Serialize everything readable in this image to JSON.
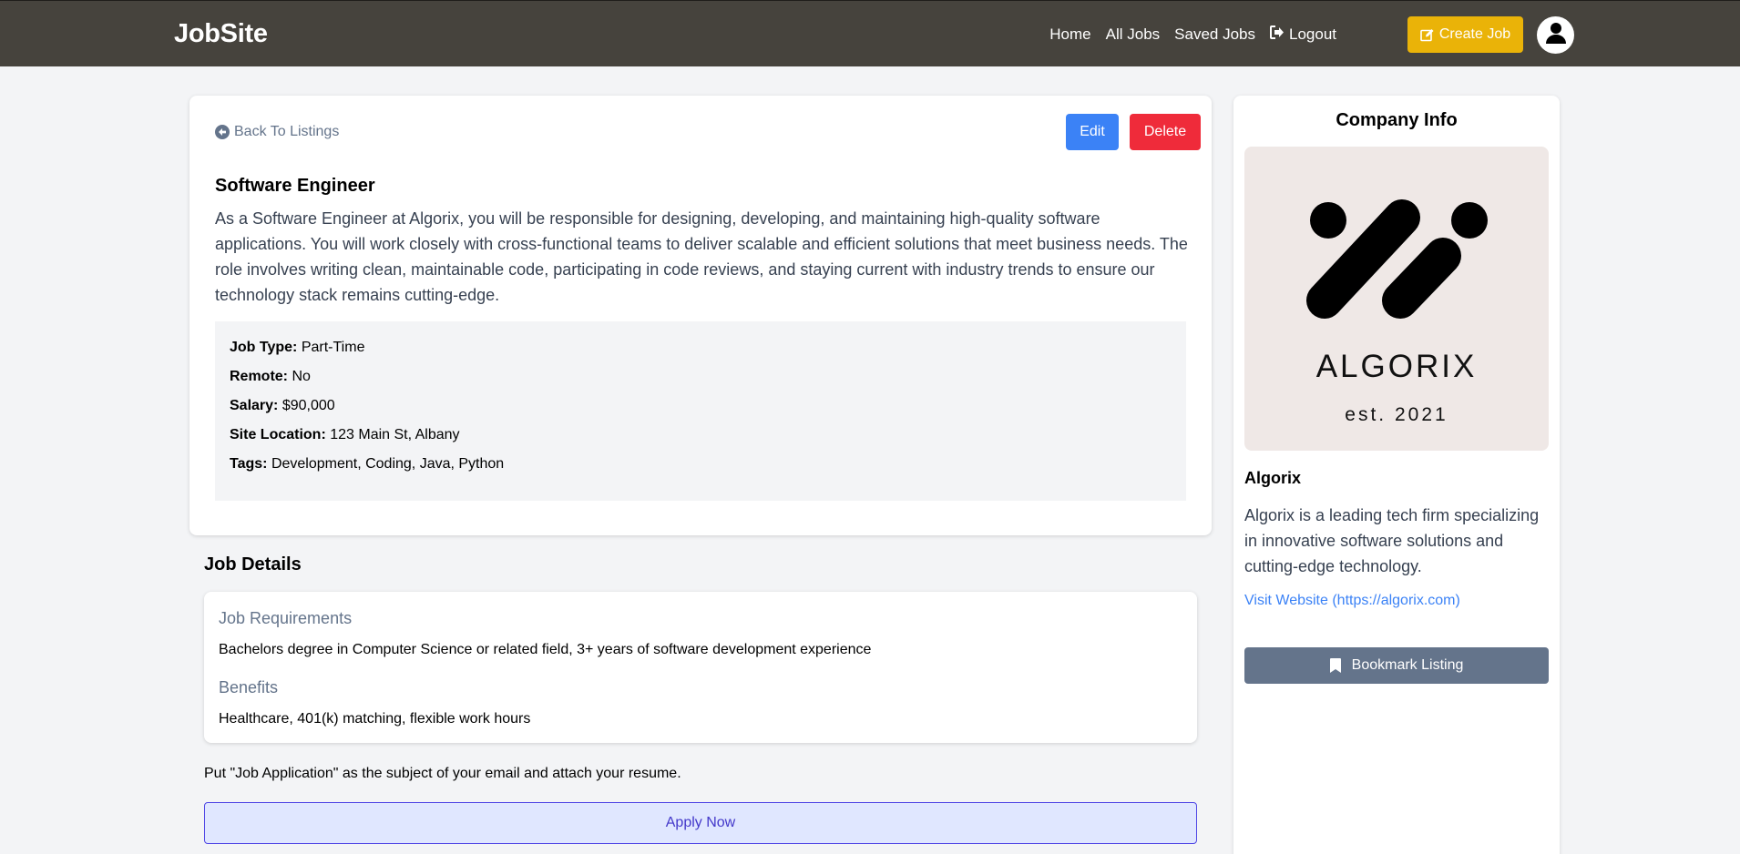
{
  "header": {
    "brand": "JobSite",
    "nav": {
      "home": "Home",
      "all_jobs": "All Jobs",
      "saved_jobs": "Saved Jobs",
      "logout": "Logout"
    },
    "create_job": "Create Job",
    "avatar_icon": "user-icon"
  },
  "listing": {
    "back_label": "Back To Listings",
    "edit_label": "Edit",
    "delete_label": "Delete",
    "title": "Software Engineer",
    "description": "As a Software Engineer at Algorix, you will be responsible for designing, developing, and maintaining high-quality software applications. You will work closely with cross-functional teams to deliver scalable and efficient solutions that meet business needs. The role involves writing clean, maintainable code, participating in code reviews, and staying current with industry trends to ensure our technology stack remains cutting-edge.",
    "info": {
      "job_type_label": "Job Type:",
      "job_type": "Part-Time",
      "remote_label": "Remote:",
      "remote": "No",
      "salary_label": "Salary:",
      "salary": "$90,000",
      "site_location_label": "Site Location:",
      "site_location": "123 Main St, Albany",
      "tags_label": "Tags:",
      "tags": "Development, Coding, Java, Python"
    }
  },
  "details": {
    "section_title": "Job Details",
    "requirements_heading": "Job Requirements",
    "requirements": "Bachelors degree in Computer Science or related field, 3+ years of software development experience",
    "benefits_heading": "Benefits",
    "benefits": "Healthcare, 401(k) matching, flexible work hours",
    "apply_note": "Put \"Job Application\" as the subject of your email and attach your resume.",
    "apply_label": "Apply Now"
  },
  "company": {
    "section_title": "Company Info",
    "logo_wordmark": "ALGORIX",
    "logo_est": "est. 2021",
    "name": "Algorix",
    "description": "Algorix is a leading tech firm specializing in innovative software solutions and cutting-edge technology.",
    "website_label": "Visit Website (https://algorix.com)",
    "bookmark_label": "Bookmark Listing"
  },
  "colors": {
    "navbar": "#46433d",
    "create_button": "#eab308",
    "edit_button": "#3b82f6",
    "delete_button": "#ef2b3a",
    "bookmark_button": "#64748b",
    "apply_button_bg": "#e0e7ff",
    "apply_button_border": "#4f46e5"
  }
}
